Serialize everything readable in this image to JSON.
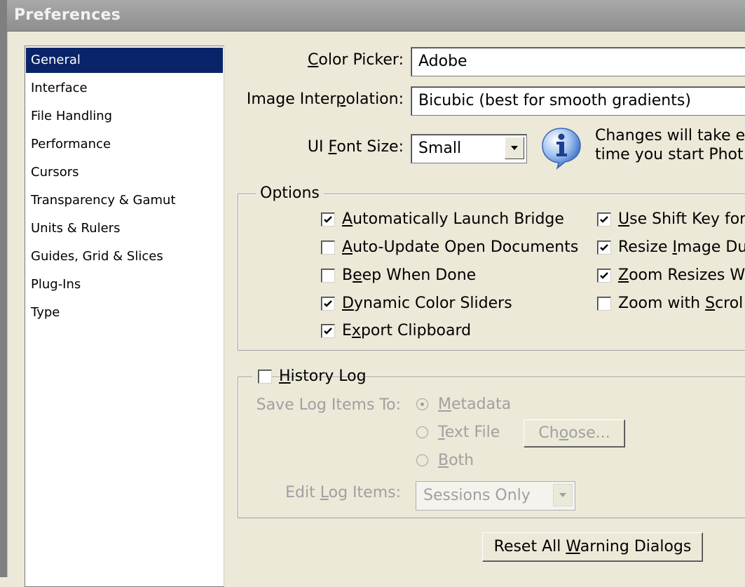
{
  "window": {
    "title": "Preferences"
  },
  "sidebar": {
    "items": [
      {
        "label": "General",
        "selected": true
      },
      {
        "label": "Interface"
      },
      {
        "label": "File Handling"
      },
      {
        "label": "Performance"
      },
      {
        "label": "Cursors"
      },
      {
        "label": "Transparency & Gamut"
      },
      {
        "label": "Units & Rulers"
      },
      {
        "label": "Guides, Grid & Slices"
      },
      {
        "label": "Plug-Ins"
      },
      {
        "label": "Type"
      }
    ]
  },
  "general": {
    "color_picker": {
      "label_pre": "",
      "label_u": "C",
      "label_post": "olor Picker:",
      "value": "Adobe"
    },
    "image_interpolation": {
      "label_pre": "Image Inter",
      "label_u": "p",
      "label_post": "olation:",
      "value": "Bicubic (best for smooth gradients)"
    },
    "ui_font_size": {
      "label_pre": "UI ",
      "label_u": "F",
      "label_post": "ont Size:",
      "value": "Small"
    },
    "info_text_line1": "Changes will take e",
    "info_text_line2": "time you start Phot",
    "info_icon": "info-icon"
  },
  "options": {
    "title": "Options",
    "left": [
      {
        "pre": "",
        "u": "A",
        "post": "utomatically Launch Bridge",
        "checked": true
      },
      {
        "pre": "",
        "u": "A",
        "post": "uto-Update Open Documents",
        "checked": false
      },
      {
        "pre": "B",
        "u": "e",
        "post": "ep When Done",
        "checked": false
      },
      {
        "pre": "",
        "u": "D",
        "post": "ynamic Color Sliders",
        "checked": true
      },
      {
        "pre": "E",
        "u": "x",
        "post": "port Clipboard",
        "checked": true
      }
    ],
    "right": [
      {
        "pre": "",
        "u": "U",
        "post": "se Shift Key for",
        "checked": true
      },
      {
        "pre": "Resize ",
        "u": "I",
        "post": "mage Du",
        "checked": true
      },
      {
        "pre": "",
        "u": "Z",
        "post": "oom Resizes W",
        "checked": true
      },
      {
        "pre": "Zoom with ",
        "u": "S",
        "post": "crol",
        "checked": false
      }
    ]
  },
  "history": {
    "title_pre": "",
    "title_u": "H",
    "title_post": "istory Log",
    "checked": false,
    "save_label": "Save Log Items To:",
    "radios": [
      {
        "pre": "",
        "u": "M",
        "post": "etadata",
        "selected": true
      },
      {
        "pre": "",
        "u": "T",
        "post": "ext File",
        "selected": false
      },
      {
        "pre": "",
        "u": "B",
        "post": "oth",
        "selected": false
      }
    ],
    "choose_button": {
      "pre": "Ch",
      "u": "o",
      "post": "ose..."
    },
    "edit_label": {
      "pre": "Edit ",
      "u": "L",
      "post": "og Items:"
    },
    "edit_value": "Sessions Only"
  },
  "reset_button": {
    "pre": "Reset All ",
    "u": "W",
    "post": "arning Dialogs"
  }
}
